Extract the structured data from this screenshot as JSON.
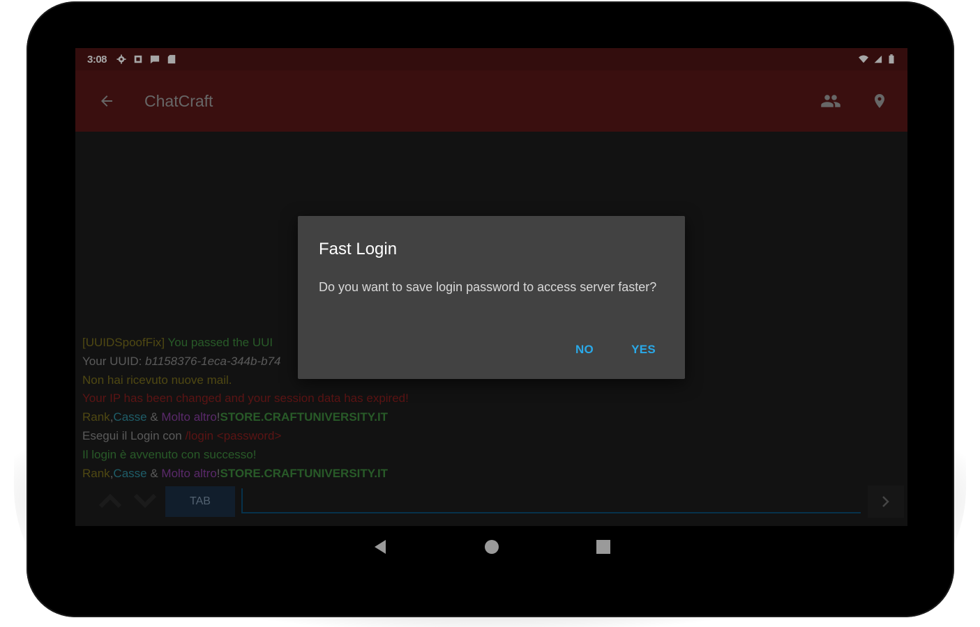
{
  "status_bar": {
    "time": "3:08",
    "left_icons": [
      "gear-icon",
      "square-icon",
      "message-icon",
      "sdcard-icon"
    ],
    "right_icons": [
      "wifi-icon",
      "signal-icon",
      "battery-icon"
    ]
  },
  "app_bar": {
    "title": "ChatCraft",
    "back_icon": "arrow-left-icon",
    "actions": [
      "people-icon",
      "location-pin-icon"
    ]
  },
  "chat": {
    "lines": [
      [
        {
          "text": "[UUIDSpoofFix] ",
          "color": "#7a6f1d"
        },
        {
          "text": "You passed the UUI",
          "color": "#3e8a3e"
        }
      ],
      [
        {
          "text": "Your UUID: ",
          "color": "#8a8a8a"
        },
        {
          "text": "b1158376-1eca-344b-b74",
          "color": "#8a8a8a",
          "style": "italic"
        }
      ],
      [
        {
          "text": "Non hai ricevuto nuove mail.",
          "color": "#7a6f1d"
        }
      ],
      [
        {
          "text": "Your IP has been changed and your session data has expired!",
          "color": "#8c1f1f"
        }
      ],
      [
        {
          "text": "Rank",
          "color": "#7a6f1d"
        },
        {
          "text": ",",
          "color": "#8a8a8a"
        },
        {
          "text": "Casse",
          "color": "#2f8fa0"
        },
        {
          "text": " & ",
          "color": "#8a8a8a"
        },
        {
          "text": "Molto altro",
          "color": "#8a3fa3"
        },
        {
          "text": "!",
          "color": "#8a8a8a"
        },
        {
          "text": "STORE.CRAFTUNIVERSITY.IT",
          "color": "#3e8a3e",
          "style": "bold"
        }
      ],
      [
        {
          "text": "Esegui il Login con ",
          "color": "#8a8a8a"
        },
        {
          "text": "/login <password>",
          "color": "#8c1f1f"
        }
      ],
      [
        {
          "text": "Il login è avvenuto con successo!",
          "color": "#3e8a3e"
        }
      ],
      [
        {
          "text": "Rank",
          "color": "#7a6f1d"
        },
        {
          "text": ",",
          "color": "#8a8a8a"
        },
        {
          "text": "Casse",
          "color": "#2f8fa0"
        },
        {
          "text": " & ",
          "color": "#8a8a8a"
        },
        {
          "text": "Molto altro",
          "color": "#8a3fa3"
        },
        {
          "text": "!",
          "color": "#8a8a8a"
        },
        {
          "text": "STORE.CRAFTUNIVERSITY.IT",
          "color": "#3e8a3e",
          "style": "bold"
        }
      ]
    ]
  },
  "input_bar": {
    "history_up_icon": "chevron-up-icon",
    "history_down_icon": "chevron-down-icon",
    "tab_label": "TAB",
    "message_value": "",
    "send_icon": "chevron-right-icon"
  },
  "nav_bar": {
    "buttons": [
      "back-triangle-icon",
      "home-circle-icon",
      "recents-square-icon"
    ]
  },
  "dialog": {
    "title": "Fast Login",
    "message": "Do you want to save login password to access server faster?",
    "negative_label": "NO",
    "positive_label": "YES"
  },
  "colors": {
    "status_bar": "#4f1414",
    "app_bar": "#5a1717",
    "accent": "#2aa9e8",
    "dialog_bg": "#424242"
  }
}
